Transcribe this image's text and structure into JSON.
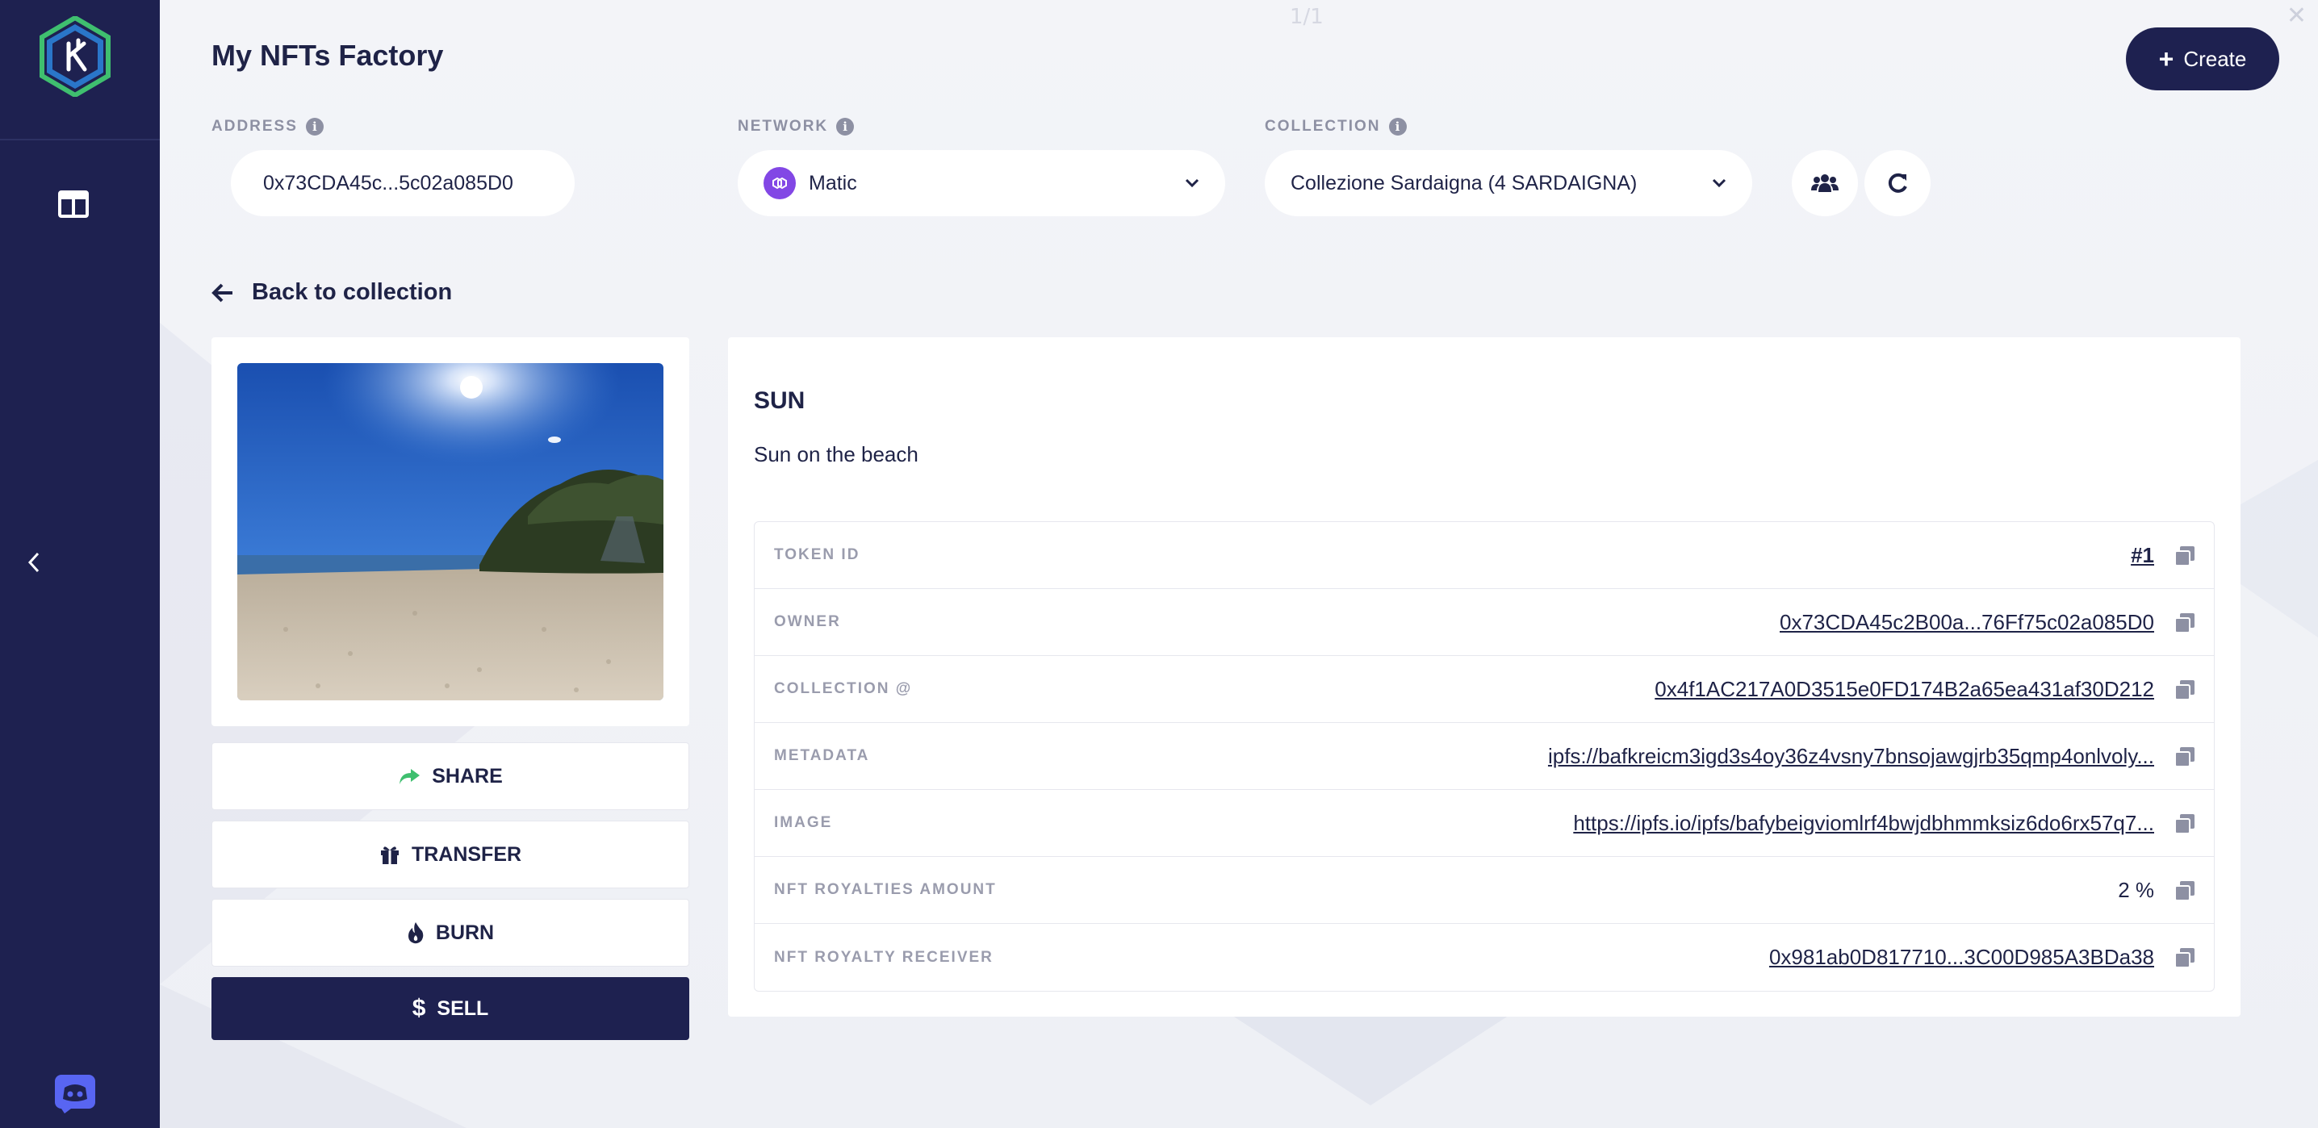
{
  "pager": "1/1",
  "header": {
    "title": "My NFTs Factory",
    "create_label": "Create"
  },
  "filters": {
    "address": {
      "label": "ADDRESS",
      "value": "0x73CDA45c...5c02a085D0"
    },
    "network": {
      "label": "NETWORK",
      "value": "Matic"
    },
    "collection": {
      "label": "COLLECTION",
      "value": "Collezione Sardaigna (4 SARDAIGNA)"
    }
  },
  "back_label": "Back to collection",
  "actions": {
    "share": "SHARE",
    "transfer": "TRANSFER",
    "burn": "BURN",
    "sell": "SELL"
  },
  "nft": {
    "name": "SUN",
    "description": "Sun on the beach",
    "rows": [
      {
        "key": "TOKEN ID",
        "value": "#1"
      },
      {
        "key": "OWNER",
        "value": "0x73CDA45c2B00a...76Ff75c02a085D0"
      },
      {
        "key": "COLLECTION @",
        "value": "0x4f1AC217A0D3515e0FD174B2a65ea431af30D212"
      },
      {
        "key": "METADATA",
        "value": "ipfs://bafkreicm3igd3s4oy36z4vsny7bnsojawgjrb35qmp4onlvoly..."
      },
      {
        "key": "IMAGE",
        "value": "https://ipfs.io/ipfs/bafybeigviomlrf4bwjdbhmmksiz6do6rx57q7..."
      },
      {
        "key": "NFT ROYALTIES AMOUNT",
        "value": "2 %"
      },
      {
        "key": "NFT ROYALTY RECEIVER",
        "value": "0x981ab0D817710...3C00D985A3BDa38"
      }
    ]
  },
  "colors": {
    "sidebar": "#1e2150",
    "primary": "#1e2150",
    "share_icon": "#3fbf6f",
    "matic": "#8247e5"
  }
}
